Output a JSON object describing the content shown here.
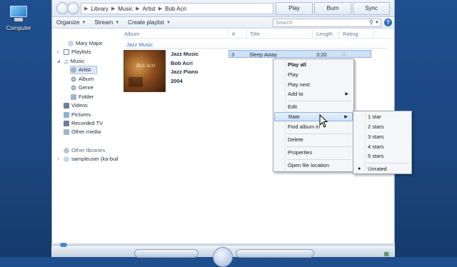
{
  "desktop": {
    "icon_label": "Computer"
  },
  "breadcrumb": [
    "Library",
    "Music",
    "Artist",
    "Bob Acri"
  ],
  "tabs": [
    "Play",
    "Burn",
    "Sync"
  ],
  "toolbar": {
    "organize": "Organize",
    "stream": "Stream",
    "create_playlist": "Create playlist",
    "search_placeholder": "Search"
  },
  "nav": {
    "user": "Mary Major",
    "playlists": "Playlists",
    "music": "Music",
    "artist": "Artist",
    "album": "Album",
    "genre": "Genre",
    "folder": "Folder",
    "videos": "Videos",
    "pictures": "Pictures",
    "recorded_tv": "Recorded TV",
    "other_media": "Other media",
    "other_libraries": "Other libraries",
    "sampleuser": "sampleuser (ka-buil"
  },
  "columns": {
    "album": "Album",
    "num": "#",
    "title": "Title",
    "length": "Length",
    "rating": "Rating"
  },
  "group": {
    "header": "Jazz Music"
  },
  "album": {
    "art_text": "Bob Acri",
    "name": "Jazz Music",
    "artist": "Bob Acri",
    "genre": "Jazz Piano",
    "year": "2004"
  },
  "track": {
    "num": "3",
    "title": "Sleep Away",
    "length": "3:20",
    "rating": 0
  },
  "context_menu": {
    "play_all": "Play all",
    "play": "Play",
    "play_next": "Play next",
    "add_to": "Add to",
    "edit": "Edit",
    "rate": "Rate",
    "find_album": "Find album in",
    "delete": "Delete",
    "properties": "Properties",
    "open_location": "Open file location"
  },
  "rate_submenu": {
    "one": "1 star",
    "two": "2 stars",
    "three": "3 stars",
    "four": "4 stars",
    "five": "5 stars",
    "unrated": "Unrated"
  },
  "colors": {
    "accent": "#2e6bc0",
    "desktop": "#1b467f",
    "highlight": "#cfe1f7"
  }
}
